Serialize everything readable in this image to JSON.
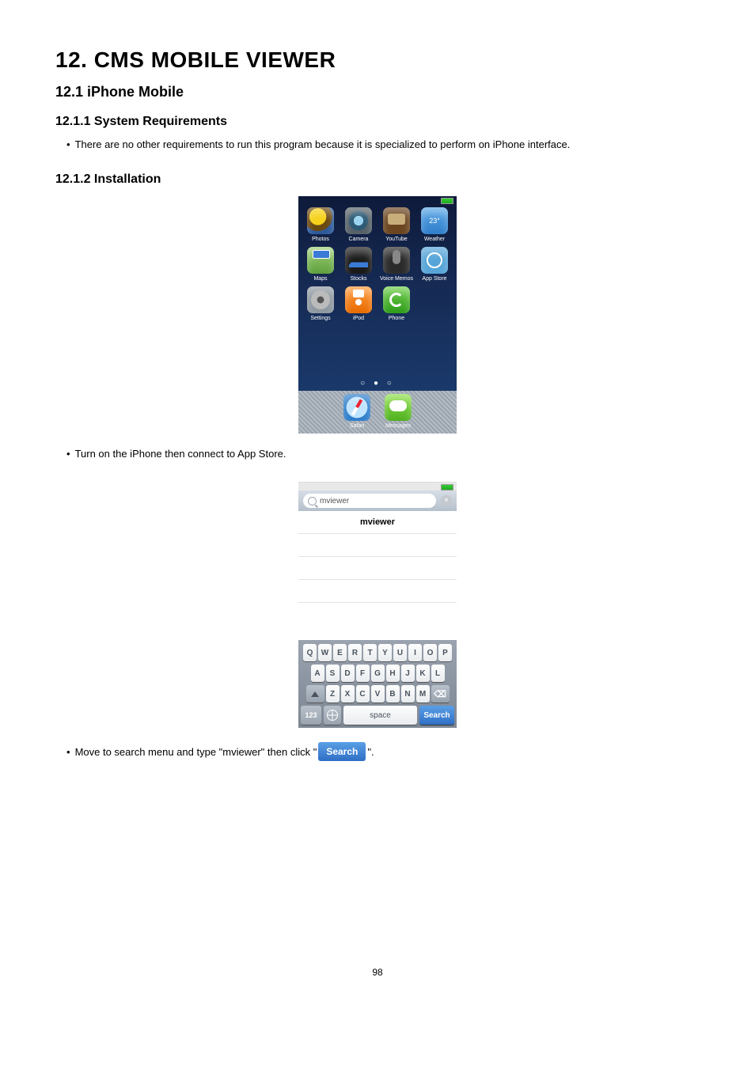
{
  "headings": {
    "chapter": "12.  CMS MOBILE VIEWER",
    "section": "12.1  iPhone Mobile",
    "sub1": "12.1.1  System Requirements",
    "sub2": "12.1.2  Installation"
  },
  "bullets": {
    "req": "There are no other requirements to run this program because it is specialized to perform on iPhone interface.",
    "step1": "Turn on the iPhone then connect to App Store.",
    "step2_pre": "Move to search menu and type \"mviewer\" then click  \"",
    "step2_post": "\"."
  },
  "home": {
    "weather_badge": "23°",
    "apps": {
      "photos": "Photos",
      "camera": "Camera",
      "youtube": "YouTube",
      "weather": "Weather",
      "maps": "Maps",
      "stocks": "Stocks",
      "vmemo": "Voice Memos",
      "appstore": "App Store",
      "settings": "Settings",
      "ipod": "iPod",
      "phone": "Phone",
      "safari": "Safari",
      "messages": "Messages"
    },
    "pager": "○ ● ○"
  },
  "search": {
    "query": "mviewer",
    "result": "mviewer",
    "kb": {
      "row1": [
        "Q",
        "W",
        "E",
        "R",
        "T",
        "Y",
        "U",
        "I",
        "O",
        "P"
      ],
      "row2": [
        "A",
        "S",
        "D",
        "F",
        "G",
        "H",
        "J",
        "K",
        "L"
      ],
      "row3": [
        "Z",
        "X",
        "C",
        "V",
        "B",
        "N",
        "M"
      ],
      "k123": "123",
      "space": "space",
      "search": "Search"
    }
  },
  "inline_button": "Search",
  "page_number": "98"
}
